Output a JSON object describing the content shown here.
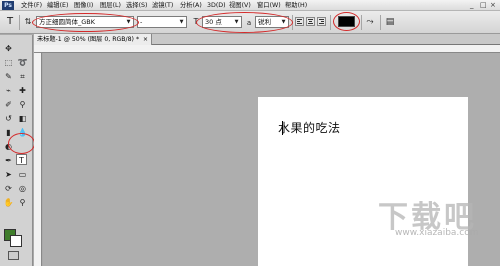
{
  "menubar": {
    "logo": "Ps",
    "items": [
      "文件(F)",
      "编辑(E)",
      "图像(I)",
      "图层(L)",
      "选择(S)",
      "滤镜(T)",
      "分析(A)",
      "3D(D)",
      "视图(V)",
      "窗口(W)",
      "帮助(H)"
    ],
    "window_controls": [
      "_",
      "□",
      "×"
    ]
  },
  "options_bar": {
    "font_family": "方正细圆简体_GBK",
    "font_style": "-",
    "font_size": "30 点",
    "antialias": "锐利",
    "text_color": "#000000",
    "tool_icon": "T"
  },
  "document": {
    "tab_title": "未标题-1 @ 50% (图层 0, RGB/8) *",
    "close_label": "×",
    "canvas_text": "水果的吃法"
  },
  "toolbox": {
    "active_tool": "T",
    "foreground_color": "#3f7d2b",
    "background_color": "#ffffff"
  },
  "watermark": {
    "text": "下载吧",
    "url": "www.xiazaiba.com"
  },
  "colors": {
    "annotation_red": "#d42a2a"
  }
}
